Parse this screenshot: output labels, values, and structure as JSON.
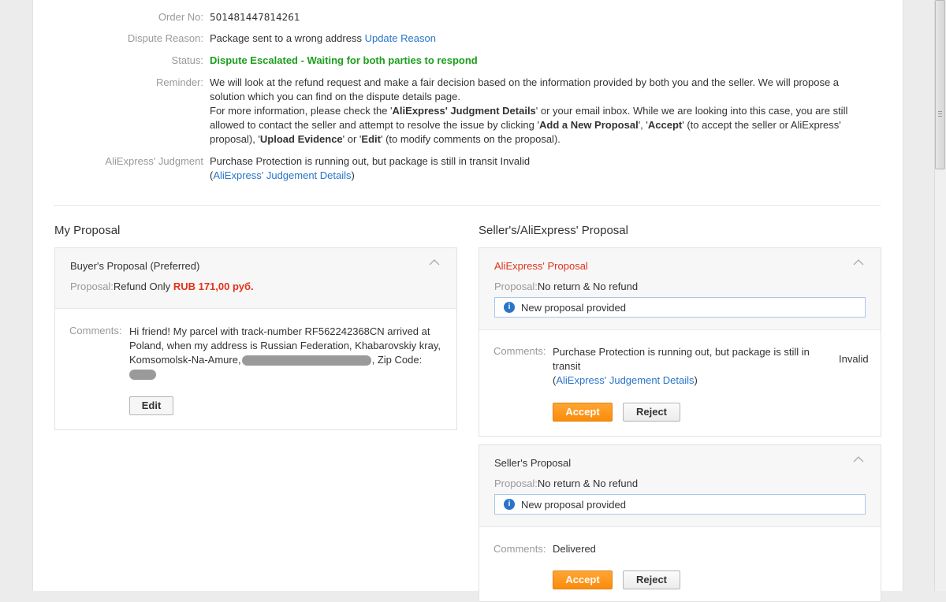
{
  "info": {
    "order_label": "Order No:",
    "order_value": "501481447814261",
    "reason_label": "Dispute Reason:",
    "reason_value": "Package sent to a wrong address",
    "reason_link": "Update Reason",
    "status_label": "Status:",
    "status_value": "Dispute Escalated - Waiting for both parties to respond",
    "reminder_label": "Reminder:",
    "reminder_line1": "We will look at the refund request and make a fair decision based on the information provided by both you and the seller. We will propose a",
    "reminder_line2": "solution which you can find on the dispute details page.",
    "reminder_p2_a": "For more information, please check the '",
    "reminder_p2_b": "AliExpress' Judgment Details",
    "reminder_p2_c": "' or your email inbox. While we are looking into this case, you are still",
    "reminder_p3_a": "allowed to contact the seller and attempt to resolve the issue by clicking '",
    "reminder_p3_b": "Add a New Proposal",
    "reminder_p3_c": "', '",
    "reminder_p3_d": "Accept",
    "reminder_p3_e": "' (to accept the seller or AliExpress'",
    "reminder_p4_a": "proposal), '",
    "reminder_p4_b": "Upload Evidence",
    "reminder_p4_c": "' or '",
    "reminder_p4_d": "Edit",
    "reminder_p4_e": "' (to modify comments on the proposal).",
    "judgment_label": "AliExpress' Judgment",
    "judgment_value": "Purchase Protection is running out, but package is still in transit Invalid",
    "judgment_link_open": "(",
    "judgment_link": "AliExpress' Judgement Details",
    "judgment_link_close": ")"
  },
  "my_proposal": {
    "section_title": "My Proposal",
    "panel_title": "Buyer's Proposal (Preferred)",
    "proposal_label": "Proposal:",
    "proposal_value": "Refund Only",
    "proposal_amount": "RUB 171,00 руб.",
    "comments_label": "Comments:",
    "comment_line1": "Hi friend! My parcel with track-number RF562242368CN arrived at",
    "comment_line2": "Poland, when my address is Russian Federation, Khabarovskiy kray,",
    "comment_line3a": "Komsomolsk-Na-Amure,",
    "comment_line3b": ", Zip Code:",
    "edit_label": "Edit"
  },
  "seller_section": {
    "section_title": "Seller's/AliExpress' Proposal",
    "aliexpress": {
      "panel_title": "AliExpress' Proposal",
      "proposal_label": "Proposal:",
      "proposal_value": "No return & No refund",
      "notice": "New proposal provided",
      "comments_label": "Comments:",
      "comment_line1": "Purchase Protection is running out, but package is still in",
      "comment_line2": "transit",
      "comment_link_open": "(",
      "comment_link": "AliExpress' Judgement Details",
      "comment_link_close": ")",
      "verdict": "Invalid",
      "accept_label": "Accept",
      "reject_label": "Reject"
    },
    "seller": {
      "panel_title": "Seller's Proposal",
      "proposal_label": "Proposal:",
      "proposal_value": "No return & No refund",
      "notice": "New proposal provided",
      "comments_label": "Comments:",
      "comment_value": "Delivered",
      "accept_label": "Accept",
      "reject_label": "Reject"
    }
  },
  "icons": {
    "collapse": "chevron-up-icon",
    "info": "info-icon"
  },
  "colors": {
    "link": "#2a74c9",
    "status_green": "#1e9e1e",
    "alert_red": "#e0331a",
    "accept_orange": "#fb8c0b"
  }
}
